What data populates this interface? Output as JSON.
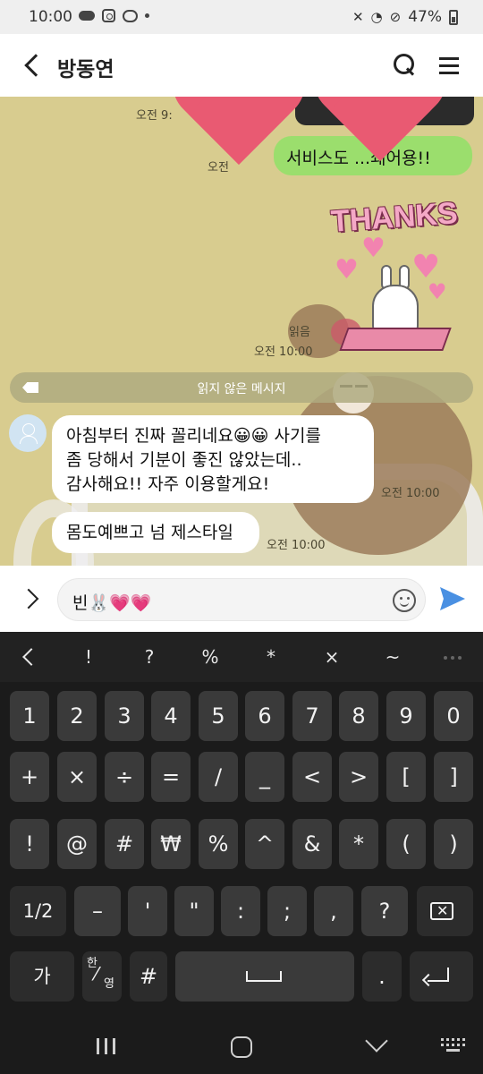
{
  "status_bar": {
    "time": "10:00",
    "battery": "47%"
  },
  "header": {
    "title": "방동연"
  },
  "chat": {
    "top_time": "오전 9:",
    "green_meta": "오전",
    "green_message": "서비스도 ...쇄어용!!",
    "sticker_text": "THANKS",
    "read_label": "읽음",
    "sticker_time": "오전 10:00",
    "unread_divider": "읽지 않은 메시지",
    "messages": [
      {
        "lines": [
          "아침부터 진짜 꼴리네요😀😀 사기를",
          "좀 당해서 기분이 좋진 않았는데..",
          "감사해요!! 자주 이용할게요!"
        ],
        "time": "오전 10:00"
      },
      {
        "text": "몸도예쁘고 넘 제스타일",
        "time": "오전 10:00"
      }
    ]
  },
  "input": {
    "value": "빈🐰💗💗"
  },
  "keyboard": {
    "symbols": [
      "!",
      "?",
      "%",
      "*",
      "×",
      "~"
    ],
    "row1": [
      "1",
      "2",
      "3",
      "4",
      "5",
      "6",
      "7",
      "8",
      "9",
      "0"
    ],
    "row2": [
      "+",
      "×",
      "÷",
      "=",
      "/",
      "_",
      "<",
      ">",
      "[",
      "]"
    ],
    "row3": [
      "!",
      "@",
      "#",
      "₩",
      "%",
      "^",
      "&",
      "*",
      "(",
      ")"
    ],
    "row4": [
      "1/2",
      "–",
      "'",
      "\"",
      ":",
      ";",
      ",",
      "?"
    ],
    "row5": {
      "lang": "가",
      "hanyoung_top": "한",
      "hanyoung_bottom": "영",
      "hash": "#",
      "period": "."
    }
  }
}
